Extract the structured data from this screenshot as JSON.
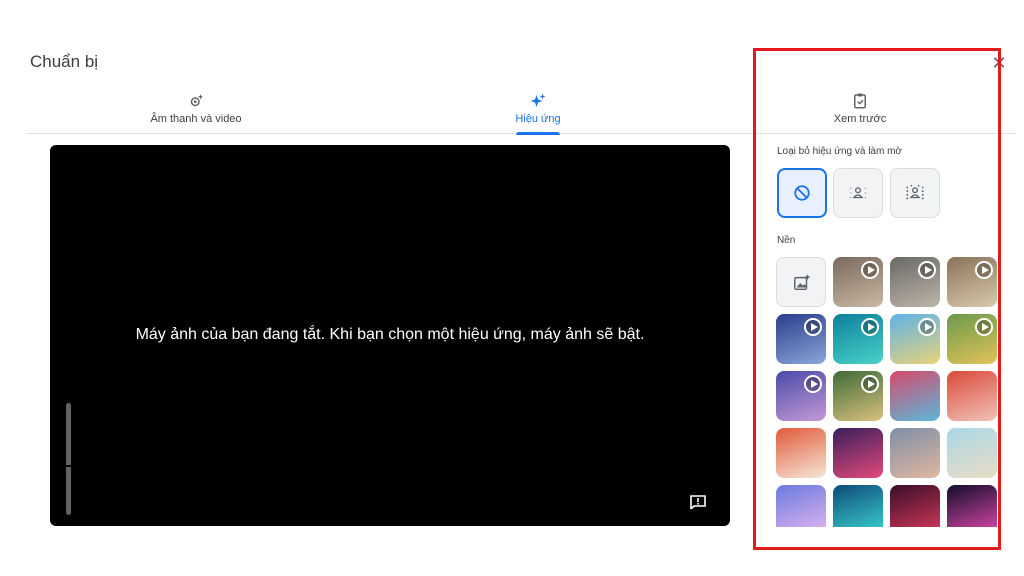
{
  "dialog": {
    "title": "Chuẩn bị"
  },
  "tabs": [
    {
      "label": "Âm thanh và video",
      "icon": "gear-sparkle-icon"
    },
    {
      "label": "Hiệu ứng",
      "icon": "sparkle-icon",
      "active": true
    },
    {
      "label": "Xem trước",
      "icon": "clipboard-check-icon"
    }
  ],
  "video": {
    "message": "Máy ảnh của bạn đang tắt. Khi bạn chọn một hiệu ứng, máy ảnh sẽ bật."
  },
  "effects": {
    "blur_section_label": "Loại bỏ hiệu ứng và làm mờ",
    "blur_options": [
      {
        "name": "no-effect",
        "icon": "block-icon",
        "selected": true
      },
      {
        "name": "slight-blur",
        "icon": "person-blur-light-icon",
        "selected": false
      },
      {
        "name": "blur",
        "icon": "person-blur-icon",
        "selected": false
      }
    ],
    "background_section_label": "Nền",
    "backgrounds": [
      {
        "kind": "upload",
        "icon": "add-image-icon"
      },
      {
        "kind": "room-1",
        "colors": [
          "#7b6a5c",
          "#c9b8a3"
        ],
        "animated": true
      },
      {
        "kind": "room-2",
        "colors": [
          "#6a6966",
          "#bdb5a9"
        ],
        "animated": true
      },
      {
        "kind": "room-3",
        "colors": [
          "#8a7358",
          "#d9c8ad"
        ],
        "animated": true
      },
      {
        "kind": "airplane",
        "colors": [
          "#2b3d8c",
          "#8aa6d9"
        ],
        "animated": true
      },
      {
        "kind": "underwater",
        "colors": [
          "#0d7f9b",
          "#4ad1c8"
        ],
        "animated": true
      },
      {
        "kind": "beach-anim",
        "colors": [
          "#5fb3e6",
          "#e7d27a"
        ],
        "animated": true
      },
      {
        "kind": "garden-anim",
        "colors": [
          "#6b9a4a",
          "#e2c25a"
        ],
        "animated": true
      },
      {
        "kind": "purple-room",
        "colors": [
          "#4b4aa8",
          "#c39ad6"
        ],
        "animated": true
      },
      {
        "kind": "forest",
        "colors": [
          "#3d6b3a",
          "#d9c07d"
        ],
        "animated": true
      },
      {
        "kind": "illustration-1",
        "colors": [
          "#d64a6c",
          "#5ab8d9"
        ],
        "animated": false
      },
      {
        "kind": "illustration-2",
        "colors": [
          "#d94a3a",
          "#f2c2b8"
        ],
        "animated": false
      },
      {
        "kind": "floral",
        "colors": [
          "#e25a3a",
          "#f5e6d8"
        ],
        "animated": false
      },
      {
        "kind": "night-lights",
        "colors": [
          "#3a1e5c",
          "#e24a7a"
        ],
        "animated": false
      },
      {
        "kind": "sunset",
        "colors": [
          "#7f8fa8",
          "#e0b7a0"
        ],
        "animated": false
      },
      {
        "kind": "seashore",
        "colors": [
          "#a9d8e6",
          "#e9dcc6"
        ],
        "animated": false
      },
      {
        "kind": "clouds",
        "colors": [
          "#6a7ae0",
          "#e5b6ef"
        ],
        "animated": false
      },
      {
        "kind": "aurora",
        "colors": [
          "#0f4a7a",
          "#3bd6d0"
        ],
        "animated": false
      },
      {
        "kind": "nebula",
        "colors": [
          "#3a0d2a",
          "#d83a5a"
        ],
        "animated": false
      },
      {
        "kind": "fireworks",
        "colors": [
          "#120d2a",
          "#e24ab0"
        ],
        "animated": false
      }
    ]
  }
}
